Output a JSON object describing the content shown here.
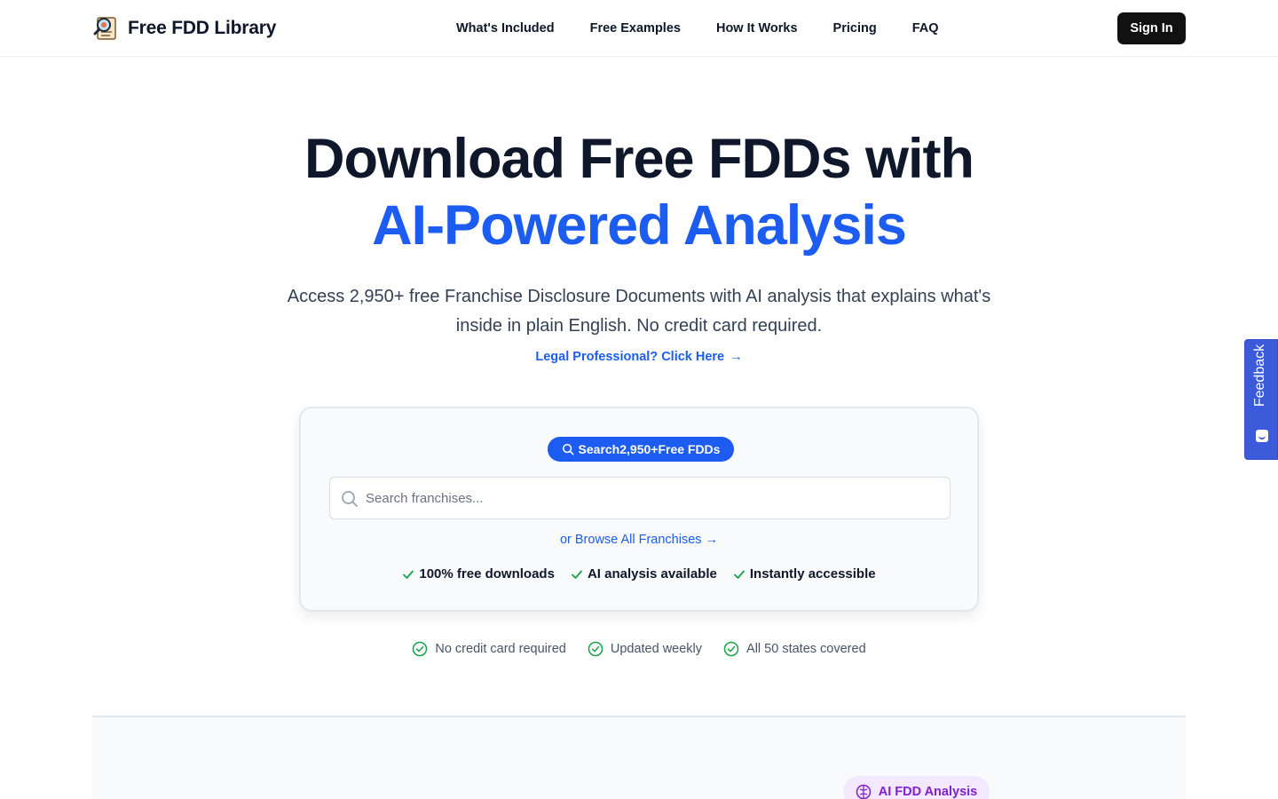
{
  "header": {
    "brand_name": "Free FDD Library",
    "nav": [
      "What's Included",
      "Free Examples",
      "How It Works",
      "Pricing",
      "FAQ"
    ],
    "signin_label": "Sign In"
  },
  "hero": {
    "title_line1": "Download Free FDDs with",
    "title_line2": "AI-Powered Analysis",
    "subtitle": "Access 2,950+ free Franchise Disclosure Documents with AI analysis that explains what's inside in plain English. No credit card required.",
    "legal_link": "Legal Professional? Click Here",
    "legal_arrow": "→"
  },
  "search": {
    "pill_label": "Search2,950+Free FDDs",
    "placeholder": "Search franchises...",
    "value": "",
    "browse_link": "or Browse All Franchises →",
    "checks": [
      "100% free downloads",
      "AI analysis available",
      "Instantly accessible"
    ]
  },
  "trust": [
    "No credit card required",
    "Updated weekly",
    "All 50 states covered"
  ],
  "lower": {
    "badge_label": "AI FDD Analysis"
  },
  "feedback": {
    "label": "Feedback"
  },
  "colors": {
    "accent": "#1d5cf0",
    "dark": "#0f172a",
    "success": "#16a34a",
    "purple": "#7e22ce",
    "feedback": "#3b5bdb"
  },
  "icons": {
    "brand": "magnifier-document-icon",
    "search": "search-icon",
    "check": "check-icon",
    "check_circle": "check-circle-icon",
    "brain": "brain-icon",
    "feedback": "chat-icon"
  }
}
